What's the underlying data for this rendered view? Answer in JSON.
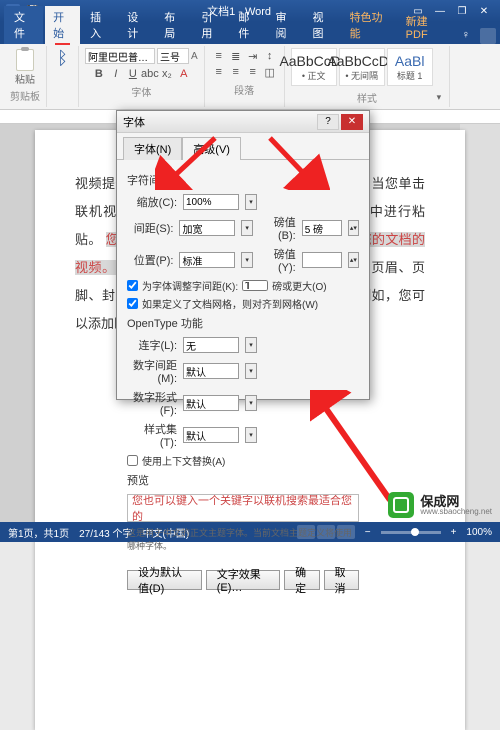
{
  "titlebar": {
    "doc_title": "文档1 - Word"
  },
  "tabs": {
    "file": "文件",
    "home": "开始",
    "insert": "插入",
    "design": "设计",
    "layout": "布局",
    "refs": "引用",
    "mail": "邮件",
    "review": "审阅",
    "view": "视图",
    "special": "特色功能",
    "pdf": "新建PDF",
    "help": "♀"
  },
  "ribbon": {
    "clipboard": {
      "paste": "粘贴",
      "label": "剪贴板"
    },
    "font": {
      "name": "阿里巴巴普…",
      "size": "三号",
      "label": "字体"
    },
    "para": {
      "label": "段落"
    },
    "styles": {
      "c1_line1": "AaBbCcDc",
      "c1_line2": "• 正文",
      "c2_line1": "AaBbCcDc",
      "c2_line2": "• 无间隔",
      "c3_line1": "AaBl",
      "c3_line2": "标题 1",
      "label": "样式"
    }
  },
  "doc": {
    "body": "视频提供了功能强大的方法帮助您证明您的观点。当您单击联机视频时，可以在想要添加的视频的嵌入代码中进行粘贴。",
    "hl": "您也可以键入一个关键字以联机搜索最适合您的文档的视频。",
    "body2": "为使您的文档具有专业外观，Word 提供了页眉、页脚、封面和文本框设计，这些设计可互为补充。例如，您可以添加匹配的封面、页眉和提要栏。"
  },
  "dialog": {
    "title": "字体",
    "tab_font": "字体(N)",
    "tab_adv": "高级(V)",
    "section1": "字符间距",
    "scale_lbl": "缩放(C):",
    "scale_val": "100%",
    "spacing_lbl": "间距(S):",
    "spacing_val": "加宽",
    "spacing_pt_lbl": "磅值(B):",
    "spacing_pt_val": "5 磅",
    "position_lbl": "位置(P):",
    "position_val": "标准",
    "position_pt_lbl": "磅值(Y):",
    "kern_chk": "为字体调整字间距(K):",
    "kern_val": "1",
    "kern_unit": "磅或更大(O)",
    "grid_chk": "如果定义了文档网格，则对齐到网格(W)",
    "section2": "OpenType 功能",
    "lig_lbl": "连字(L):",
    "lig_val": "无",
    "numspc_lbl": "数字间距(M):",
    "numspc_val": "默认",
    "numform_lbl": "数字形式(F):",
    "numform_val": "默认",
    "styset_lbl": "样式集(T):",
    "styset_val": "默认",
    "ctx_chk": "使用上下文替换(A)",
    "preview_lbl": "预览",
    "preview_text": "您也可以键入一个关键字以联机搜索最适合您的",
    "note": "这是用于中文的正文主题字体。当前文档主题定义将使用哪种字体。",
    "btn_default": "设为默认值(D)",
    "btn_effects": "文字效果(E)…",
    "btn_ok": "确定",
    "btn_cancel": "取消"
  },
  "status": {
    "page": "第1页，共1页",
    "words": "27/143 个字",
    "lang": "中文(中国)",
    "zoom": "100%"
  },
  "watermark": {
    "cn": "保成网",
    "en": "www.sbaocheng.net"
  }
}
